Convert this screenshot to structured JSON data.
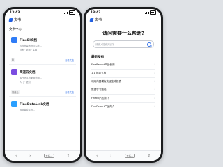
{
  "left_phone": {
    "status_time": "13:43",
    "app_title": "文书",
    "section_title": "文书中心",
    "docs": [
      {
        "name": "FineBI文档",
        "desc": "包含大量教程与实践…",
        "desc2": "技术 · 培训 · 实践",
        "tag": "BI",
        "more": "查看文档",
        "color": "#2f7cf6"
      },
      {
        "name": "简道云文档",
        "desc": "零代码平台使用说明…",
        "desc2": "入门 · 进阶",
        "tag": "简道云",
        "more": "查看文档",
        "color": "#7b4de0"
      },
      {
        "name": "FineDataLink文档",
        "desc": "数据集成平台…",
        "desc2": "",
        "tag": "",
        "more": "",
        "color": "#2aa0ff"
      }
    ],
    "url_label": "文书…",
    "nav_back": "‹",
    "nav_forward": "›",
    "nav_share": "⇪"
  },
  "right_phone": {
    "status_time": "13:43",
    "app_title": "文书",
    "hero_title": "请问需要什么帮助?",
    "search_placeholder": "请输入搜索关键字",
    "latest_title": "最新发布",
    "articles": [
      "FineReport产品使用",
      "1.1 指导文档",
      "利用内置模板快速生成报表",
      "数据学习路径",
      "FineBI产品简介",
      "FineReport产品简介"
    ],
    "chevron": "›",
    "url_label": "文书…",
    "nav_back": "‹",
    "nav_forward": "›",
    "nav_share": "⇪"
  }
}
